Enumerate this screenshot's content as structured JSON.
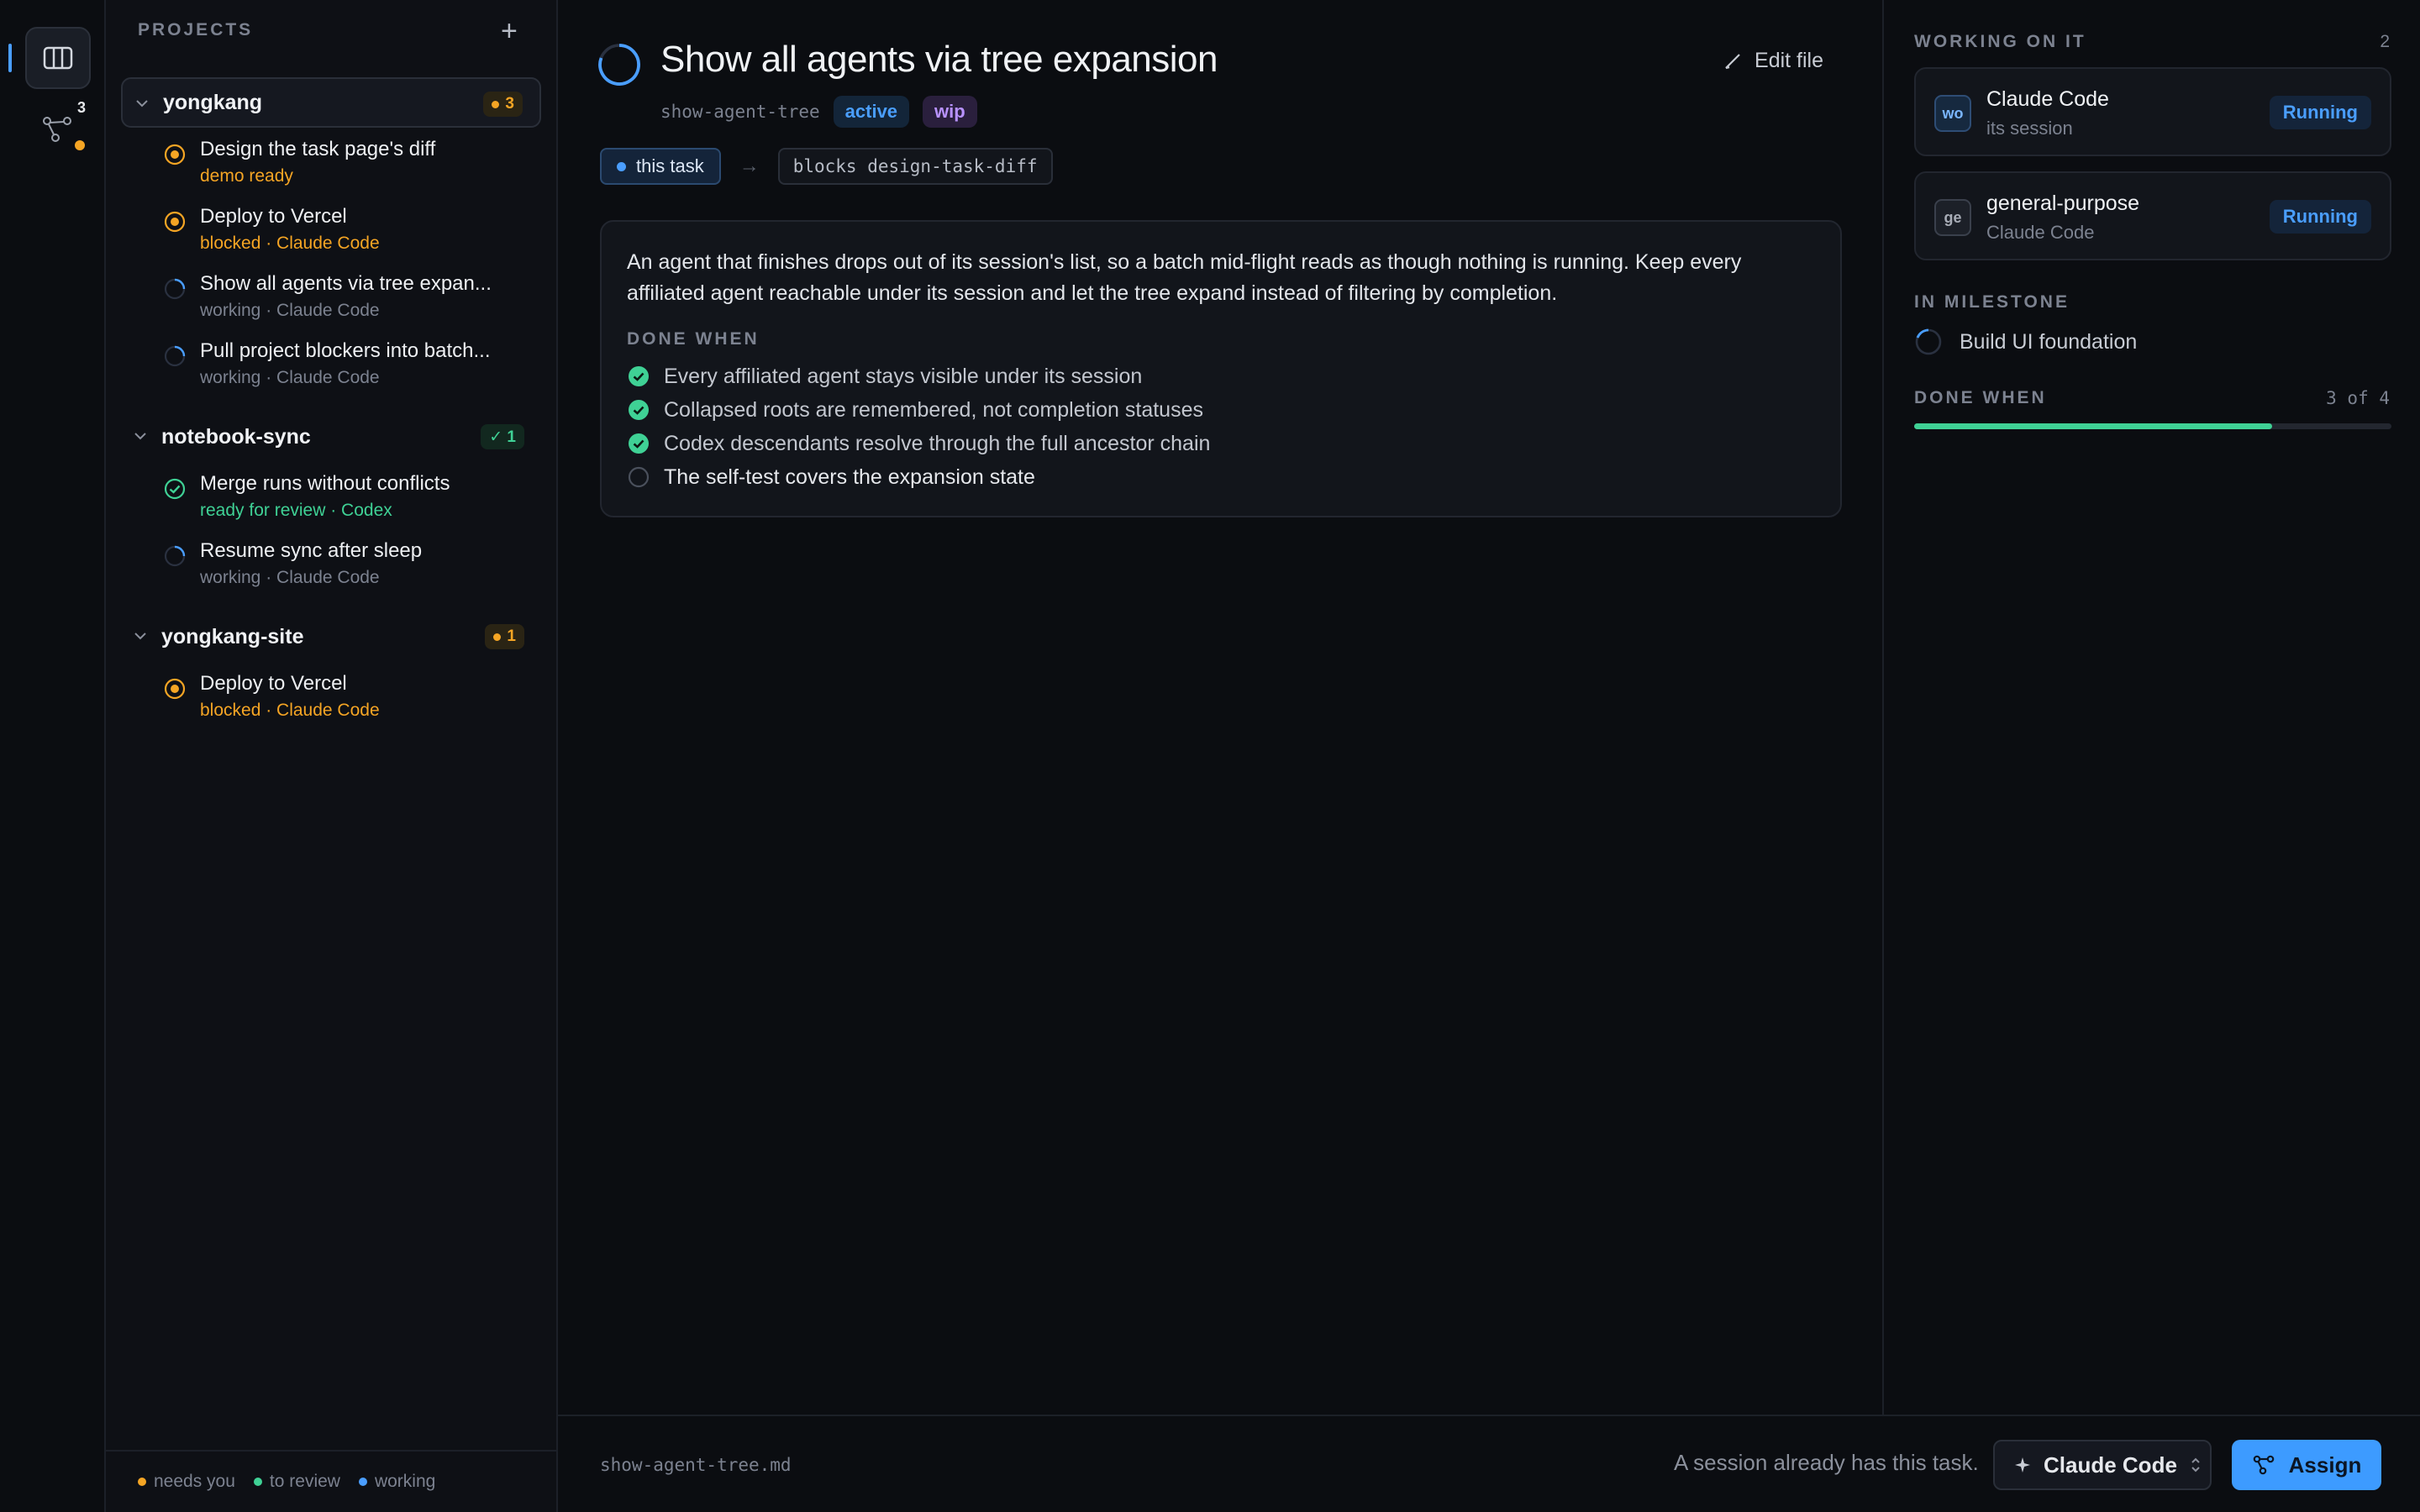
{
  "rail": {
    "tree_count": "3"
  },
  "sidebar": {
    "header": "PROJECTS",
    "add_glyph": "+",
    "projects": [
      {
        "name": "yongkang",
        "badge": "3",
        "tasks": [
          {
            "title": "Design the task page's diff",
            "status": "demo ready",
            "icon": "needs-you"
          },
          {
            "title": "Deploy to Vercel",
            "status": "blocked · Claude Code",
            "icon": "needs-you"
          },
          {
            "title": "Show all agents via tree expan...",
            "status": "working · Claude Code",
            "icon": "working"
          },
          {
            "title": "Pull project blockers into batch...",
            "status": "working · Claude Code",
            "icon": "working"
          }
        ]
      },
      {
        "name": "notebook-sync",
        "badge": "✓ 1",
        "tasks": [
          {
            "title": "Merge runs without conflicts",
            "status": "ready for review · Codex",
            "icon": "review"
          },
          {
            "title": "Resume sync after sleep",
            "status": "working · Claude Code",
            "icon": "working"
          }
        ]
      },
      {
        "name": "yongkang-site",
        "badge": "1",
        "tasks": [
          {
            "title": "Deploy to Vercel",
            "status": "blocked · Claude Code",
            "icon": "needs-you"
          }
        ]
      }
    ],
    "legend": {
      "needs_you": "needs you",
      "to_review": "to review",
      "working": "working"
    }
  },
  "task": {
    "title": "Show all agents via tree expansion",
    "slug": "show-agent-tree",
    "tags": [
      "active",
      "wip"
    ],
    "edit_label": "Edit file",
    "dependency": {
      "this_task": "this task",
      "arrow": "→",
      "blocks": "blocks design-task-diff"
    },
    "description": "An agent that finishes drops out of its session's list, so a batch mid-flight reads as though nothing is running. Keep every affiliated agent reachable under its session and let the tree expand instead of filtering by completion.",
    "done_when_heading": "DONE WHEN",
    "done_when": [
      {
        "text": "Every affiliated agent stays visible under its session",
        "done": true
      },
      {
        "text": "Collapsed roots are remembered, not completion statuses",
        "done": true
      },
      {
        "text": "Codex descendants resolve through the full ancestor chain",
        "done": true
      },
      {
        "text": "The self-test covers the expansion state",
        "done": false
      }
    ]
  },
  "footer": {
    "file": "show-agent-tree.md",
    "note": "A session already has this task.",
    "agent": "Claude Code",
    "assign": "Assign"
  },
  "panel": {
    "working_heading": "WORKING ON IT",
    "working_count": "2",
    "agents": [
      {
        "initials": "wo",
        "name": "Claude Code",
        "sub": "its session",
        "status": "Running"
      },
      {
        "initials": "ge",
        "name": "general-purpose",
        "sub": "Claude Code",
        "status": "Running"
      }
    ],
    "milestone_heading": "IN MILESTONE",
    "milestone": "Build UI foundation",
    "done_heading": "DONE WHEN",
    "done_count": "3 of 4",
    "progress": 0.75
  },
  "colors": {
    "accent": "#4a9eff",
    "needs_you": "#f5a524",
    "review": "#3fd195",
    "assign": "#3d9bff"
  }
}
